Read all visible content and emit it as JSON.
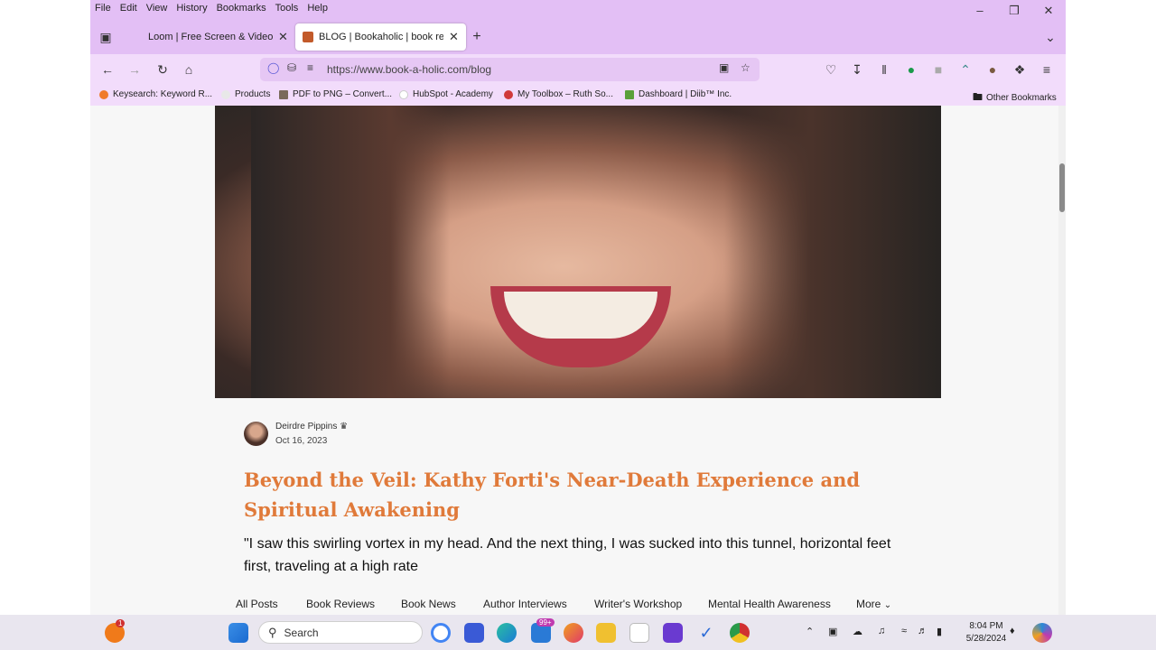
{
  "menubar": {
    "items": [
      "File",
      "Edit",
      "View",
      "History",
      "Bookmarks",
      "Tools",
      "Help"
    ]
  },
  "tabs": [
    {
      "label": "Loom | Free Screen & Video Re",
      "active": false
    },
    {
      "label": "BLOG | Bookaholic | book revie",
      "active": true
    }
  ],
  "navbar": {
    "url": "https://www.book-a-holic.com/blog"
  },
  "bookmarks": [
    "Keysearch: Keyword R...",
    "Products",
    "PDF to PNG – Convert...",
    "HubSpot - Academy",
    "My Toolbox – Ruth So...",
    "Dashboard | Diib™ Inc."
  ],
  "other_bookmarks": "Other Bookmarks",
  "post": {
    "author": "Deirdre Pippins",
    "date": "Oct 16, 2023",
    "title": "Beyond the Veil: Kathy Forti's Near-Death Experience and Spiritual Awakening",
    "excerpt": "\"I saw this swirling vortex in my head. And the next thing, I was sucked into this tunnel, horizontal feet first, traveling at a high rate"
  },
  "categories": [
    "All Posts",
    "Book Reviews",
    "Book News",
    "Author Interviews",
    "Writer's Workshop",
    "Mental Health Awareness",
    "More"
  ],
  "taskbar": {
    "search_placeholder": "Search",
    "mail_badge": "99+",
    "notif_badge": "1",
    "time": "8:04 PM",
    "date": "5/28/2024"
  },
  "colors": {
    "chrome": "#e3bff5",
    "accent": "#e07a3a"
  }
}
